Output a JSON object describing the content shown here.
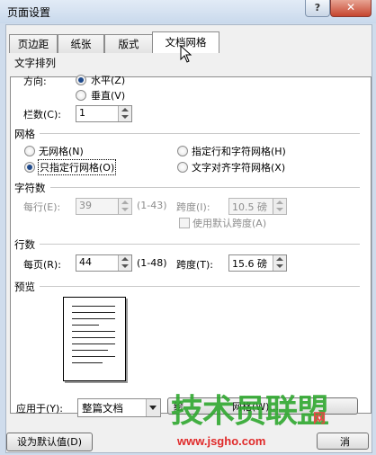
{
  "window": {
    "title": "页面设置",
    "help": "?",
    "close": "✕"
  },
  "tabs": [
    {
      "label": "页边距"
    },
    {
      "label": "纸张"
    },
    {
      "label": "版式"
    },
    {
      "label": "文档网格"
    }
  ],
  "text_direction": {
    "heading": "文字排列",
    "direction_label": "方向:",
    "horizontal": "水平(Z)",
    "vertical": "垂直(V)",
    "columns_label": "栏数(C):",
    "columns_value": "1"
  },
  "grid": {
    "heading": "网格",
    "no_grid": "无网格(N)",
    "line_only": "只指定行网格(O)",
    "line_char": "指定行和字符网格(H)",
    "snap_char": "文字对齐字符网格(X)"
  },
  "chars": {
    "heading": "字符数",
    "per_line_label": "每行(E):",
    "per_line_value": "39",
    "per_line_range": "(1-43)",
    "pitch_label": "跨度(I):",
    "pitch_value": "10.5 磅",
    "default_pitch": "使用默认跨度(A)"
  },
  "lines": {
    "heading": "行数",
    "per_page_label": "每页(R):",
    "per_page_value": "44",
    "per_page_range": "(1-48)",
    "pitch_label": "跨度(T):",
    "pitch_value": "15.6 磅"
  },
  "preview": {
    "heading": "预览"
  },
  "apply": {
    "label": "应用于(Y):",
    "value": "整篇文档",
    "draw_grid_partial": "绘",
    "draw_grid_tail": "网格(W)..."
  },
  "footer": {
    "set_default": "设为默认值(D)",
    "cancel_partial": "消"
  },
  "watermark": {
    "brand": "技术员联盟",
    "net": "网",
    "url": "www.jsgho.com"
  }
}
